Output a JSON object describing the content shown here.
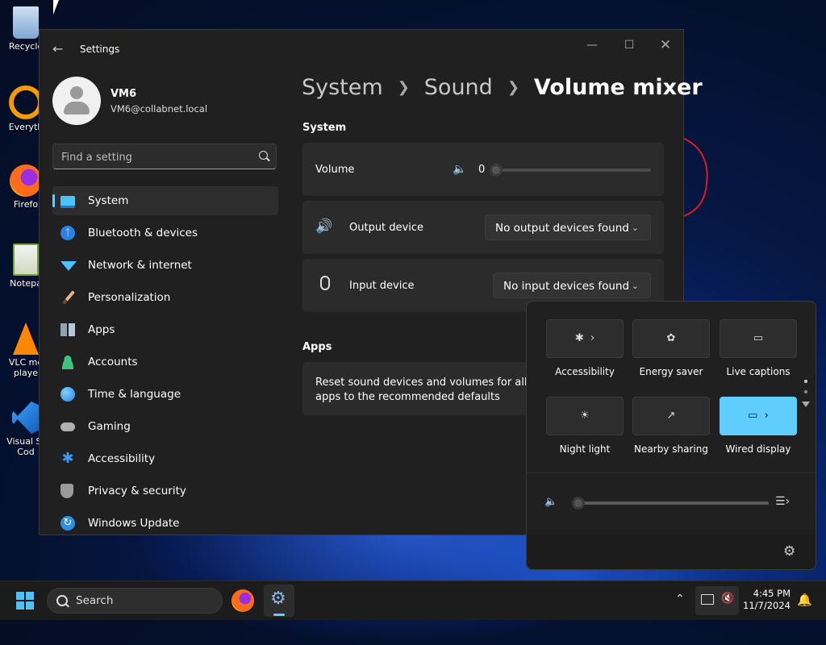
{
  "desktop": {
    "icons": [
      {
        "label": "Recycle",
        "icon": "recycle-bin-icon",
        "color": "#8fb3d9"
      },
      {
        "label": "Everyth",
        "icon": "everything-search-icon",
        "color": "#f59b00"
      },
      {
        "label": "Firefo",
        "icon": "firefox-icon",
        "color": "#ff6b1a"
      },
      {
        "label": "Notepa",
        "icon": "notepad-plus-icon",
        "color": "#9bd35a"
      },
      {
        "label": "VLC me playe",
        "icon": "vlc-icon",
        "color": "#ff8800"
      },
      {
        "label": "Visual St Cod",
        "icon": "vscode-icon",
        "color": "#1e8ad6"
      }
    ]
  },
  "window": {
    "title": "Settings",
    "profile": {
      "name": "VM6",
      "email": "VM6@collabnet.local"
    },
    "search_placeholder": "Find a setting",
    "nav": [
      {
        "label": "System",
        "icon": "system-display-icon",
        "color": "#4cc2ff",
        "selected": true
      },
      {
        "label": "Bluetooth & devices",
        "icon": "bluetooth-icon",
        "color": "#2a82e4"
      },
      {
        "label": "Network & internet",
        "icon": "wifi-icon",
        "color": "#4cc2ff"
      },
      {
        "label": "Personalization",
        "icon": "paintbrush-icon",
        "color": "#e8b57c"
      },
      {
        "label": "Apps",
        "icon": "apps-icon",
        "color": "#8fa2b8"
      },
      {
        "label": "Accounts",
        "icon": "accounts-icon",
        "color": "#3ec27f"
      },
      {
        "label": "Time & language",
        "icon": "globe-clock-icon",
        "color": "#3aa3e8"
      },
      {
        "label": "Gaming",
        "icon": "gamepad-icon",
        "color": "#b0b0b0"
      },
      {
        "label": "Accessibility",
        "icon": "accessibility-icon",
        "color": "#3a9cf0"
      },
      {
        "label": "Privacy & security",
        "icon": "shield-icon",
        "color": "#9a9a9a"
      },
      {
        "label": "Windows Update",
        "icon": "windows-update-icon",
        "color": "#2d8fe8"
      }
    ],
    "breadcrumb": {
      "first": "System",
      "second": "Sound",
      "current": "Volume mixer"
    },
    "system_section": {
      "title": "System",
      "volume_label": "Volume",
      "volume_value": "0",
      "output_label": "Output device",
      "output_value": "No output devices found",
      "input_label": "Input device",
      "input_value": "No input devices found"
    },
    "apps_section": {
      "title": "Apps",
      "reset_text_line1": "Reset sound devices and volumes for all",
      "reset_text_line2": "apps to the recommended defaults"
    }
  },
  "quick_settings": {
    "tiles": [
      {
        "label": "Accessibility",
        "icon": "accessibility-icon",
        "has_arrow": true,
        "on": false
      },
      {
        "label": "Energy saver",
        "icon": "leaf-icon",
        "has_arrow": false,
        "on": false
      },
      {
        "label": "Live captions",
        "icon": "captions-icon",
        "has_arrow": false,
        "on": false
      },
      {
        "label": "Night light",
        "icon": "sun-icon",
        "has_arrow": false,
        "on": false
      },
      {
        "label": "Nearby sharing",
        "icon": "share-icon",
        "has_arrow": false,
        "on": false
      },
      {
        "label": "Wired display",
        "icon": "cast-icon",
        "has_arrow": true,
        "on": true
      }
    ],
    "volume_level": 0,
    "accent": "#60cdff"
  },
  "taskbar": {
    "search_label": "Search",
    "time": "4:45 PM",
    "date": "11/7/2024"
  }
}
